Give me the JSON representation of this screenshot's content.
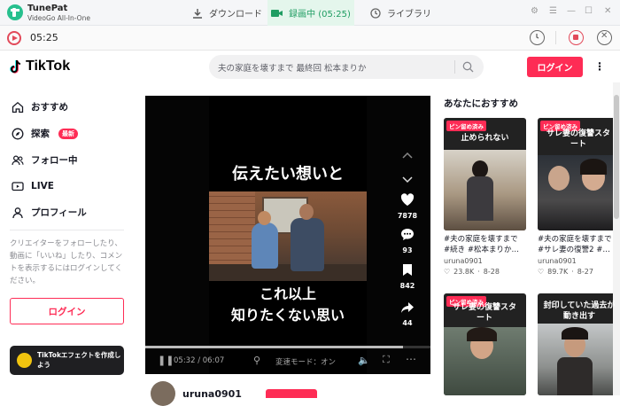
{
  "app": {
    "name": "TunePat",
    "subtitle": "VideoGo All-In-One"
  },
  "tabs": [
    {
      "label": "ダウンロード",
      "icon": "download-icon"
    },
    {
      "label": "録画中 (05:25)",
      "icon": "video-camera-icon",
      "active": true
    },
    {
      "label": "ライブラリ",
      "icon": "clock-icon"
    }
  ],
  "window_icons": [
    "settings-icon",
    "menu-icon",
    "minimize-icon",
    "maximize-icon",
    "close-icon"
  ],
  "recording": {
    "time": "05:25"
  },
  "tiktok": {
    "logo": "TikTok",
    "search_placeholder": "夫の家庭を壊すまで 最終回 松本まりか",
    "login": "ログイン"
  },
  "sidebar": {
    "items": [
      {
        "label": "おすすめ",
        "icon": "home-icon"
      },
      {
        "label": "探索",
        "icon": "compass-icon",
        "badge": "最新"
      },
      {
        "label": "フォロー中",
        "icon": "users-icon"
      },
      {
        "label": "LIVE",
        "icon": "live-icon"
      },
      {
        "label": "プロフィール",
        "icon": "user-icon"
      }
    ],
    "hint": "クリエイターをフォローしたり、動画に「いいね」したり、コメントを表示するにはログインしてください。",
    "login": "ログイン",
    "effect_banner": "TikTokエフェクトを作成しよう"
  },
  "video": {
    "caption_top": "伝えたい想いと",
    "caption_bottom_1": "これ以上",
    "caption_bottom_2": "知りたくない思い",
    "time": "05:32 / 06:07",
    "progress": 0.905,
    "speed": "変速モード：オン",
    "likes": "7878",
    "comments": "93",
    "saves": "842",
    "shares": "44",
    "author": "uruna0901"
  },
  "recommendations": {
    "title": "あなたにおすすめ",
    "cards": [
      {
        "pin": "ピン留め済み",
        "caption": "止められない",
        "title": "#夫の家庭を壊すまで #続き #松本まりか…",
        "user": "uruna0901",
        "likes": "23.8K",
        "date": "8-28"
      },
      {
        "pin": "ピン留め済み",
        "caption": "サレ妻の復讐スタート",
        "title": "#夫の家庭を壊すまで #サレ妻の復讐2 #…",
        "user": "uruna0901",
        "likes": "89.7K",
        "date": "8-27"
      },
      {
        "pin": "ピン留め済み",
        "caption": "サレ妻の復讐スタート",
        "title": "",
        "user": "",
        "likes": "",
        "date": ""
      },
      {
        "pin": "",
        "caption": "封印していた過去が動き出す",
        "title": "",
        "user": "",
        "likes": "",
        "date": ""
      }
    ]
  },
  "colors": {
    "accent": "#fe2c55",
    "green": "#1f9d62",
    "recording": "#e24a5a"
  }
}
